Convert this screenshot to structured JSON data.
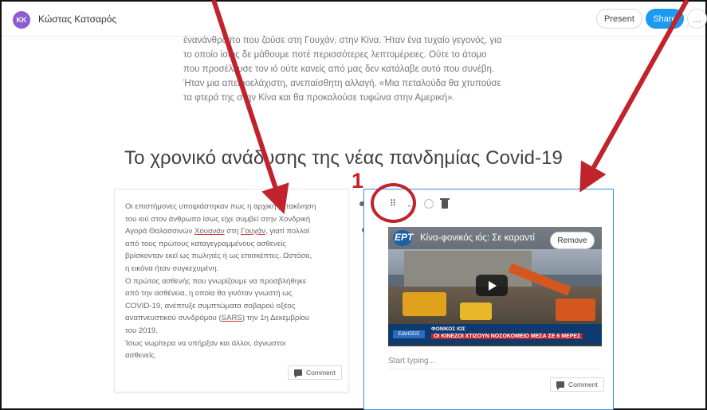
{
  "header": {
    "avatar_initials": "KK",
    "user_name": "Κώστας Κατσαρός",
    "present_label": "Present",
    "share_label": "Share",
    "more_label": "..."
  },
  "intro": {
    "line1": "ένανάνθρωπο που ζούσε στη Γουχάν, στην Κίνα. Ήταν ένα τυχαίο γεγονός, για",
    "line2": "το οποίο ίσως δε μάθουμε ποτέ περισσότερες λεπτομέρειες. Ούτε το άτομο",
    "line3": "που προσέλκυσε τον ιό ούτε κανείς από μας δεν κατάλαβε αυτό που συνέβη.",
    "line4": "Ήταν μια απειροελάχιστη, ανεπαίσθητη αλλαγή. «Μια πεταλούδα θα χτυπούσε",
    "line5": "τα φτερά της στην Κίνα και θα προκαλούσε τυφώνα στην Αμερική»."
  },
  "heading": "Το χρονικό ανάδυσης της νέας πανδημίας Covid-19",
  "left_card": {
    "l1": "Οι επιστήμονες υποψιάστηκαν πως η αρχική μετακίνηση",
    "l2": "του ιού στον άνθρωπο ίσως είχε συμβεί στην Χονδρική",
    "l3a": "Αγορά Θαλασσινών ",
    "l3b": "Χουανάν",
    "l3c": " στη ",
    "l3d": "Γουχάν",
    "l3e": ", γιατί πολλοί",
    "l4": "από τους πρώτους καταγεγραμμένους ασθενείς",
    "l5": "βρίσκονταν εκεί ως πωλητές ή ως επισκέπτες. Ωστόσο,",
    "l6": "η εικόνα ήταν συγκεχυμένη.",
    "l7": "Ο πρώτος ασθενής που γνωρίζουμε να προσβλήθηκε",
    "l8": "από την ασθένεια, η οποία θα γινόταν γνωστή ως",
    "l9": "COVID-19, ανέπτυξε συμπτώματα σοβαρού οξέος",
    "l10a": "αναπνευστικού συνδρόμου (",
    "l10b": "SARS",
    "l10c": ") την 1η Δεκεμβρίου",
    "l11": "του 2019.",
    "l12": "Ίσως νωρίτερα να υπήρξαν και άλλοι, άγνωστοι",
    "l13": "ασθενείς.",
    "comment_label": "Comment"
  },
  "right_card": {
    "annotation_number": "1",
    "video_channel": "ΕΡΤ",
    "video_title": "Κίνα-φονικός ιός: Σε καραντί",
    "remove_label": "Remove",
    "caption_badge": "ΕΙΔΗΣΕΙΣ",
    "caption_line1": "ΦΟΝΙΚΟΣ ΙΟΣ",
    "caption_line2": "ΟΙ ΚΙΝΕΖΟΙ ΧΤΙΖΟΥΝ ΝΟΣΟΚΟΜΕΙΟ ΜΕΣΑ ΣΕ 6 ΜΕΡΕΣ",
    "typing_placeholder": "Start typing...",
    "comment_label": "Comment"
  },
  "colors": {
    "accent": "#1a9af0",
    "selection_border": "#3a8dde",
    "annotation_red": "#c0232b",
    "avatar": "#8e5bd6"
  }
}
